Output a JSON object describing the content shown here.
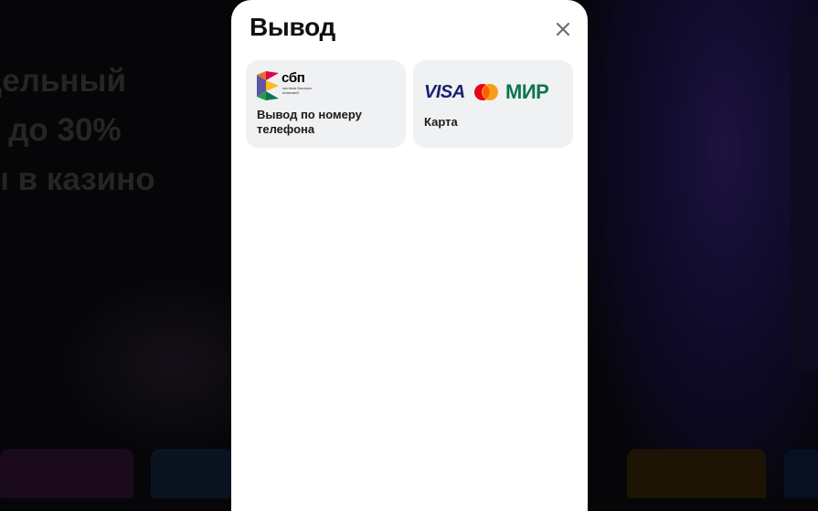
{
  "background": {
    "headline_lines": [
      "дельный",
      "х до 30%",
      "ы в казино"
    ]
  },
  "modal": {
    "title": "Вывод",
    "close_icon": "close-icon",
    "options": [
      {
        "logo": "sbp-logo",
        "logo_text": "сбп",
        "logo_subtext": "система быстрых платежей",
        "label": "Вывод по номеру телефона"
      },
      {
        "logos": [
          "VISA",
          "mastercard",
          "МИР"
        ],
        "label": "Карта"
      }
    ]
  },
  "colors": {
    "overlay": "#060608",
    "modal_bg": "#ffffff",
    "option_bg": "#f0f1f3",
    "visa": "#1a1f71",
    "mir": "#0f754e",
    "mc_red": "#eb001b",
    "mc_yellow": "#f79e1b"
  }
}
